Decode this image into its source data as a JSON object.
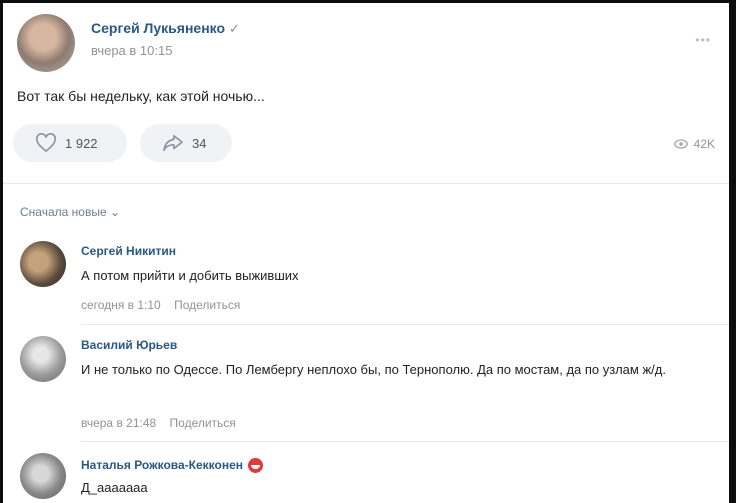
{
  "post": {
    "author": "Сергей Лукьяненко",
    "verified_mark": "✓",
    "time": "вчера в 10:15",
    "more": "•••",
    "text": "Вот так бы недельку, как этой ночью...",
    "likes": "1 922",
    "shares": "34",
    "views": "42K"
  },
  "comments_header": {
    "sort_label": "Сначала новые",
    "sort_chevron": "⌄"
  },
  "comments": [
    {
      "name": "Сергей Никитин",
      "text": "А потом прийти и добить выживших",
      "time": "сегодня в 1:10",
      "share": "Поделиться"
    },
    {
      "name": "Василий Юрьев",
      "text": "И не только по Одессе. По Лембергу неплохо бы, по Тернополю. Да по мостам, да по узлам ж/д.",
      "time": "вчера в 21:48",
      "share": "Поделиться"
    },
    {
      "name": "Наталья Рожкова-Кекконен",
      "text": "Д_ааааааа"
    }
  ],
  "colors": {
    "link": "#2a5885",
    "muted": "#939393",
    "pill": "#f0f2f5"
  }
}
